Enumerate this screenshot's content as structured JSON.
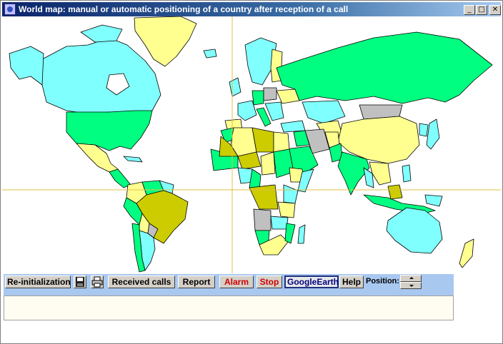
{
  "window": {
    "title": "World map: manual or automatic positioning of a country after reception of a call",
    "min_glyph": "_",
    "max_glyph": "□",
    "close_glyph": "✕"
  },
  "toolbar": {
    "reinit_label": "Re-initialization",
    "save_icon": "floppy-disk-icon",
    "print_icon": "printer-icon",
    "received_calls_label": "Received calls",
    "report_label": "Report",
    "alarm_label": "Alarm",
    "stop_label": "Stop",
    "google_earth_label": "GoogleEarth",
    "help_label": "Help",
    "position_label": "Position:"
  },
  "colors": {
    "green": "#00ff80",
    "cyan": "#80ffff",
    "yellow": "#ffff90",
    "olive": "#cccc00",
    "gray": "#c0c0c0",
    "crosshair": "#e0c040",
    "toolbar_bg": "#a8c8f0",
    "alarm_text": "#d00000"
  },
  "notes_text": ""
}
